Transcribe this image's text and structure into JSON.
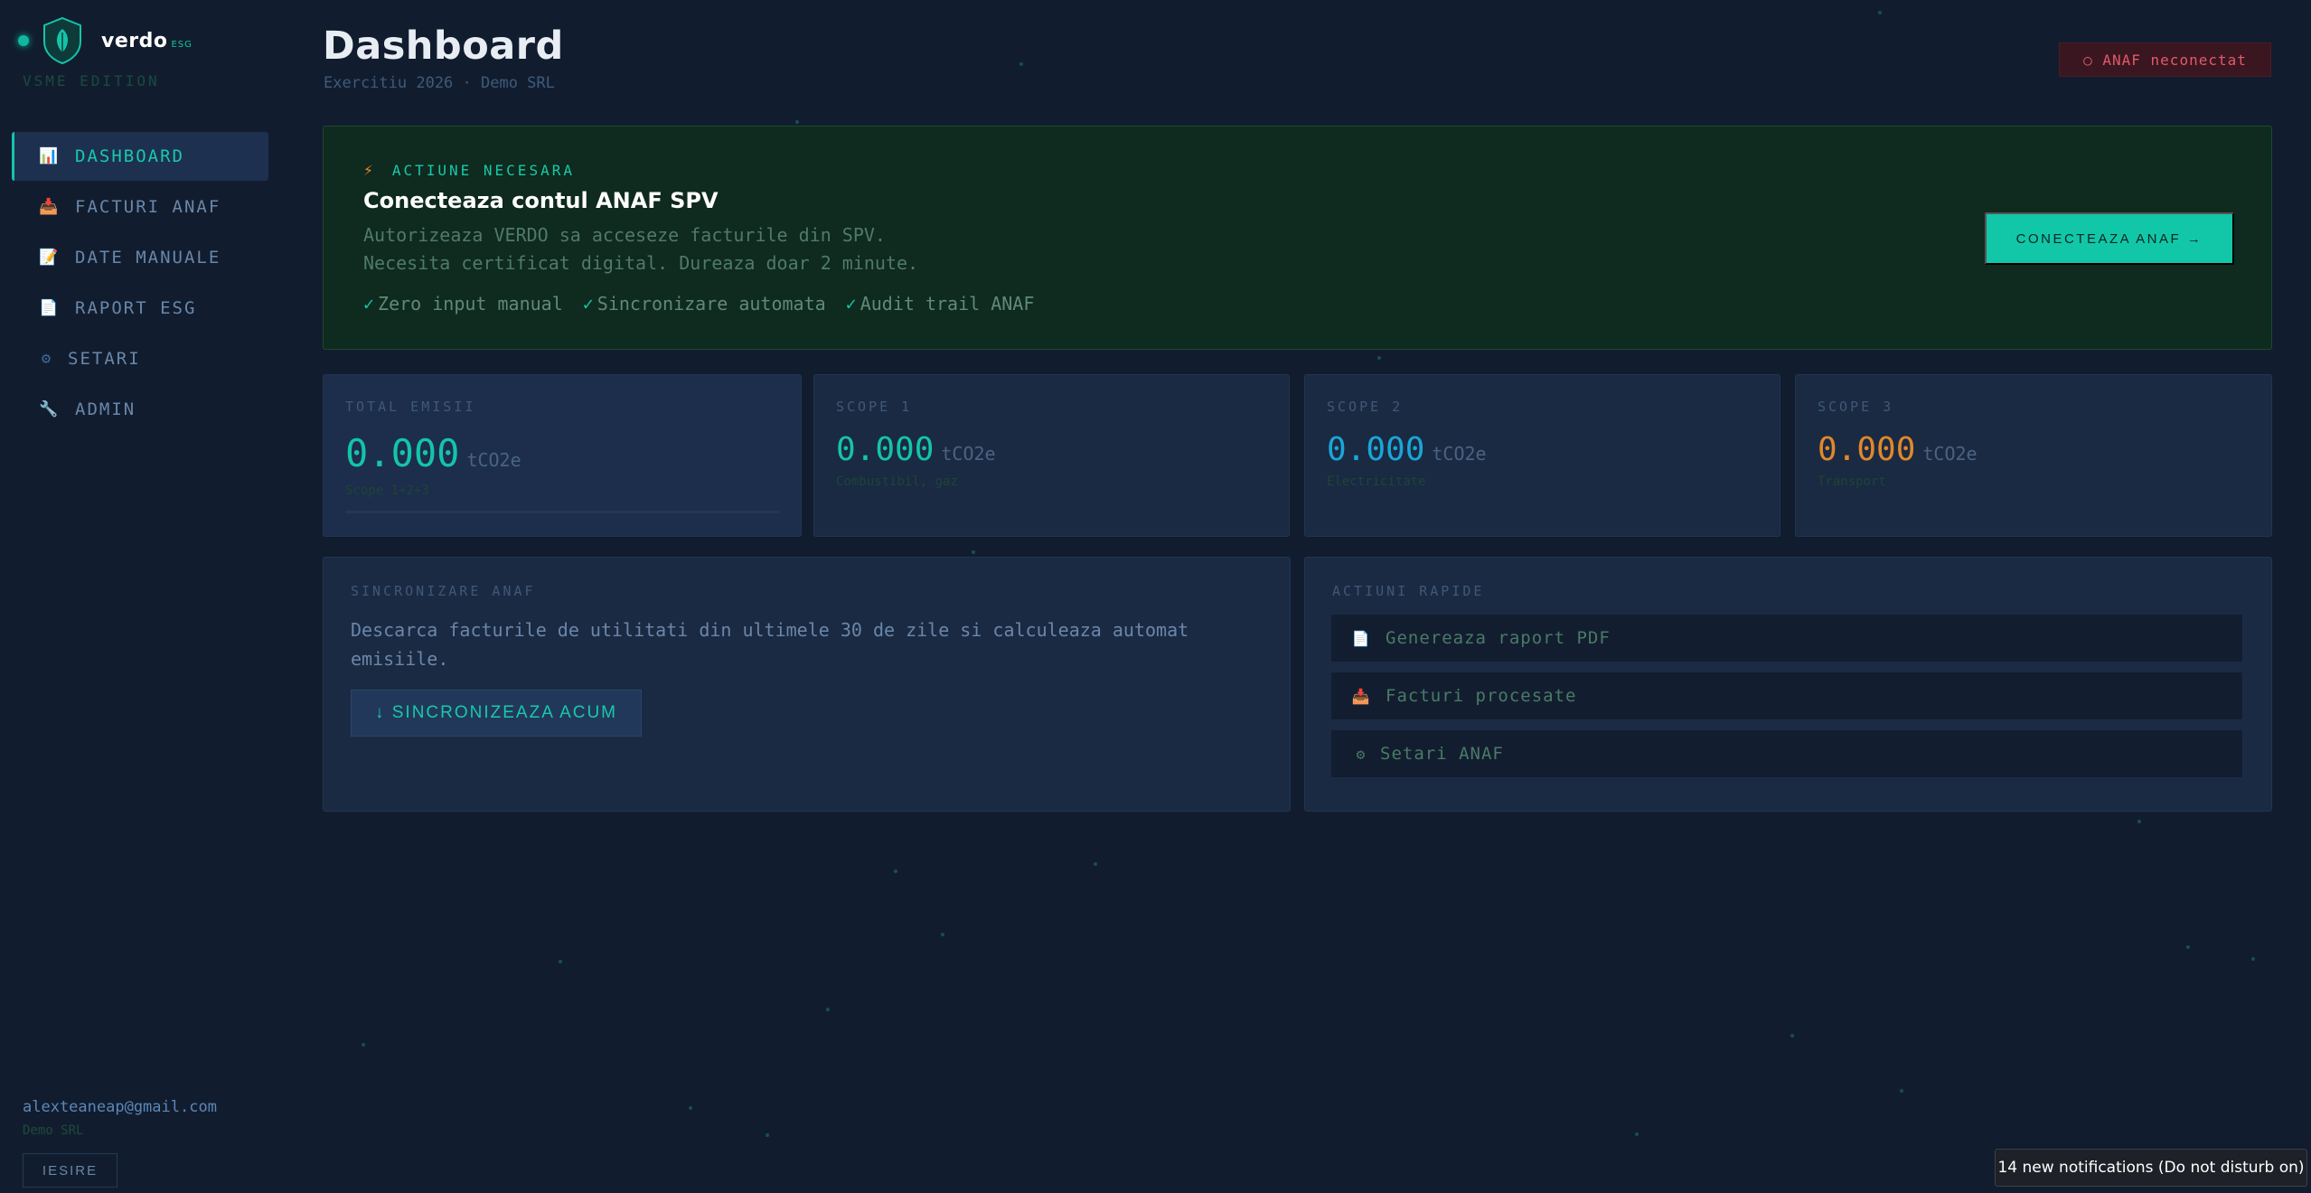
{
  "brand": {
    "name": "verdo",
    "suffix": "ESG",
    "edition": "VSME EDITION"
  },
  "sidebar": {
    "items": [
      {
        "label": "DASHBOARD",
        "icon": "bar-chart-icon",
        "glyph": "📊",
        "active": true
      },
      {
        "label": "FACTURI ANAF",
        "icon": "inbox-tray-icon",
        "glyph": "📥",
        "active": false
      },
      {
        "label": "DATE MANUALE",
        "icon": "memo-icon",
        "glyph": "📝",
        "active": false
      },
      {
        "label": "RAPORT ESG",
        "icon": "document-icon",
        "glyph": "📄",
        "active": false
      },
      {
        "label": "SETARI",
        "icon": "gear-icon",
        "glyph": "⚙",
        "active": false
      },
      {
        "label": "ADMIN",
        "icon": "wrench-icon",
        "glyph": "🔧",
        "active": false
      }
    ],
    "user": {
      "email": "alexteaneap@gmail.com",
      "org": "Demo SRL"
    },
    "exit_label": "IESIRE"
  },
  "header": {
    "title": "Dashboard",
    "subtitle": "Exercitiu 2026 · Demo SRL",
    "anaf_status": "○ ANAF neconectat"
  },
  "banner": {
    "kicker": "ACTIUNE NECESARA",
    "title": "Conecteaza contul ANAF SPV",
    "line1": "Autorizeaza VERDO sa acceseze facturile din SPV.",
    "line2": "Necesita certificat digital. Dureaza doar 2 minute.",
    "checks": [
      "Zero input manual",
      "Sincronizare automata",
      "Audit trail ANAF"
    ],
    "button": "CONECTEAZA ANAF →"
  },
  "stats": [
    {
      "label": "TOTAL EMISII",
      "value": "0.000",
      "unit": "tCO2e",
      "sub": "Scope 1+2+3",
      "color": "#14c4a8"
    },
    {
      "label": "SCOPE 1",
      "value": "0.000",
      "unit": "tCO2e",
      "sub": "Combustibil, gaz",
      "color": "#14c4a8"
    },
    {
      "label": "SCOPE 2",
      "value": "0.000",
      "unit": "tCO2e",
      "sub": "Electricitate",
      "color": "#1aa6d8"
    },
    {
      "label": "SCOPE 3",
      "value": "0.000",
      "unit": "tCO2e",
      "sub": "Transport",
      "color": "#e0882a"
    }
  ],
  "sync": {
    "label": "SINCRONIZARE ANAF",
    "description": "Descarca facturile de utilitati din ultimele 30 de zile si calculeaza automat emisiile.",
    "button": "↓ SINCRONIZEAZA ACUM"
  },
  "quick_actions": {
    "label": "ACTIUNI RAPIDE",
    "items": [
      {
        "label": "Genereaza raport PDF",
        "icon": "document-icon",
        "glyph": "📄"
      },
      {
        "label": "Facturi procesate",
        "icon": "inbox-tray-icon",
        "glyph": "📥"
      },
      {
        "label": "Setari ANAF",
        "icon": "gear-icon",
        "glyph": "⚙"
      }
    ]
  },
  "toast": "14 new notifications (Do not disturb on)"
}
